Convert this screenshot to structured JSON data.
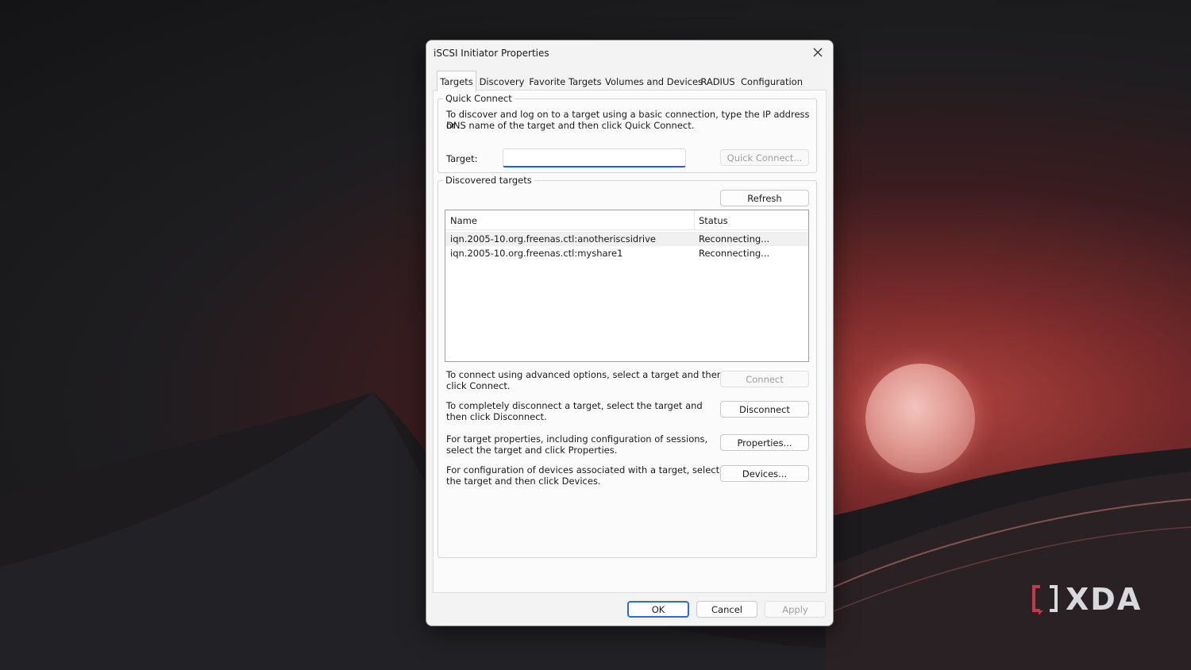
{
  "dialog": {
    "title": "iSCSI Initiator Properties",
    "tabs": [
      "Targets",
      "Discovery",
      "Favorite Targets",
      "Volumes and Devices",
      "RADIUS",
      "Configuration"
    ],
    "active_tab": "Targets"
  },
  "quick_connect": {
    "legend": "Quick Connect",
    "description_line1": "To discover and log on to a target using a basic connection, type the IP address or",
    "description_line2": "DNS name of the target and then click Quick Connect.",
    "target_label": "Target:",
    "target_value": "",
    "quick_connect_button": "Quick Connect..."
  },
  "discovered": {
    "legend": "Discovered targets",
    "refresh_button": "Refresh",
    "columns": [
      "Name",
      "Status"
    ],
    "rows": [
      {
        "name": "iqn.2005-10.org.freenas.ctl:anotheriscsidrive",
        "status": "Reconnecting..."
      },
      {
        "name": "iqn.2005-10.org.freenas.ctl:myshare1",
        "status": "Reconnecting..."
      }
    ]
  },
  "actions": {
    "connect_text_1": "To connect using advanced options, select a target and then",
    "connect_text_2": "click Connect.",
    "connect_button": "Connect",
    "disconnect_text_1": "To completely disconnect a target, select the target and",
    "disconnect_text_2": "then click Disconnect.",
    "disconnect_button": "Disconnect",
    "properties_text_1": "For target properties, including configuration of sessions,",
    "properties_text_2": "select the target and click Properties.",
    "properties_button": "Properties...",
    "devices_text_1": "For configuration of devices associated with a target, select",
    "devices_text_2": "the target and then click Devices.",
    "devices_button": "Devices..."
  },
  "footer": {
    "ok": "OK",
    "cancel": "Cancel",
    "apply": "Apply"
  },
  "watermark": "XDA"
}
